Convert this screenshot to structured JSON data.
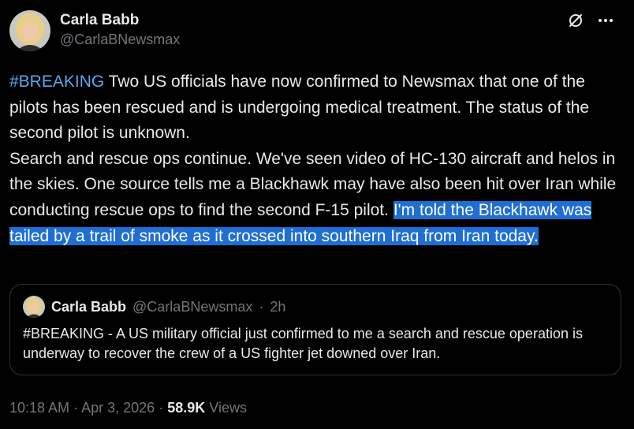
{
  "author": {
    "display_name": "Carla Babb",
    "handle": "@CarlaBNewsmax"
  },
  "header": {
    "grok_icon": "grok-slash-circle-icon",
    "more_icon": "more-horizontal-icon"
  },
  "tweet": {
    "hashtag": "#BREAKING",
    "text_plain": " Two US officials have now confirmed to Newsmax that one of the pilots has been rescued and is undergoing medical treatment. The status of the second pilot is unknown.",
    "text_para2": "Search and rescue ops continue. We've seen video of HC-130 aircraft and helos in the skies. One source tells me a Blackhawk may have also been hit over Iran while conducting rescue ops to find the second F-15 pilot.",
    "text_highlighted": "I'm told the Blackhawk was tailed by a trail of smoke as it crossed into southern Iraq from Iran today."
  },
  "quote": {
    "display_name": "Carla Babb",
    "handle": "@CarlaBNewsmax",
    "separator": "·",
    "time": "2h",
    "text": "#BREAKING - A US military official just confirmed to me a search and rescue operation is underway to recover the crew of a US fighter jet downed over Iran."
  },
  "footer": {
    "time": "10:18 AM",
    "separator1": "·",
    "date": "Apr 3, 2026",
    "separator2": "·",
    "views_count": "58.9K",
    "views_label": "Views"
  },
  "colors": {
    "background": "#000000",
    "text": "#e7e9ea",
    "muted": "#71767b",
    "hashtag": "#5aa8ee",
    "highlight": "#1f6ed4",
    "border": "#2f3336"
  }
}
